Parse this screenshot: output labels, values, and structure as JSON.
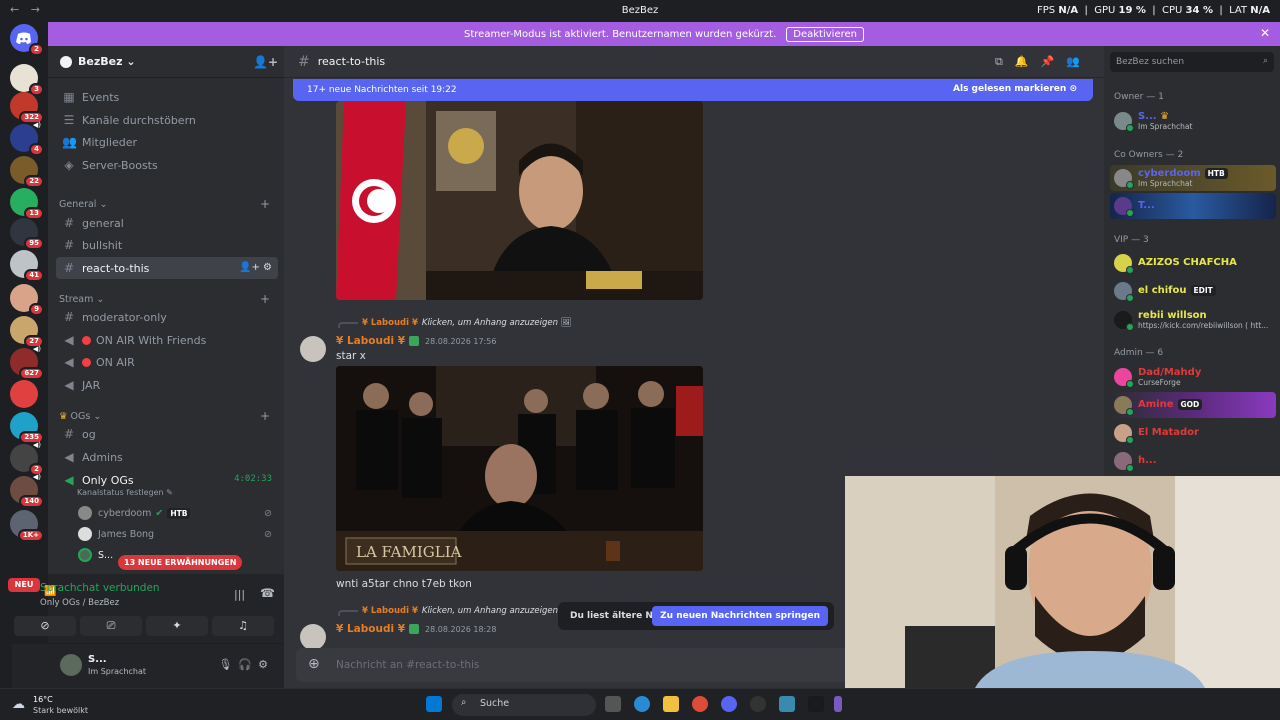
{
  "titlebar": {
    "nav": "← →",
    "title": "BezBez",
    "fps_label": "FPS",
    "fps": "N/A",
    "gpu_label": "GPU",
    "gpu": "19 %",
    "cpu_label": "CPU",
    "cpu": "34 %",
    "lat_label": "LAT",
    "lat": "N/A"
  },
  "banner": {
    "text": "Streamer-Modus ist aktiviert. Benutzernamen wurden gekürzt.",
    "button": "Deaktivieren",
    "close": "✕"
  },
  "servers": {
    "badges": [
      "2",
      "3",
      "322",
      "4",
      "22",
      "13",
      "95",
      "41",
      "9",
      "27",
      "627",
      "235",
      "2",
      "140",
      "1K+"
    ],
    "neu": "NEU"
  },
  "guild": {
    "name": "BezBez ⌄"
  },
  "nav_items": [
    "Events",
    "Kanäle durchstöbern",
    "Mitglieder",
    "Server-Boosts"
  ],
  "categories": {
    "general": "General ⌄",
    "stream": "Stream ⌄",
    "ogs": "OGs ⌄"
  },
  "channels": {
    "general": [
      "general",
      "bullshit",
      "react-to-this"
    ],
    "stream": [
      "moderator-only",
      "ON AIR With Friends",
      "ON AIR",
      "JAR"
    ],
    "ogs": [
      "og",
      "Admins",
      "Only OGs"
    ]
  },
  "voice": {
    "timer": "4:02:33",
    "status": "Kanalstatus festlegen",
    "users": [
      {
        "name": "cyberdoom",
        "tag": "HTB"
      },
      {
        "name": "James Bong"
      },
      {
        "name": "S..."
      }
    ],
    "mentions": "13 NEUE ERWÄHNUNGEN"
  },
  "voicepanel": {
    "title": "Sprachchat verbunden",
    "subtitle": "Only OGs / BezBez"
  },
  "user": {
    "name": "S...",
    "status": "Im Sprachchat"
  },
  "chat": {
    "channel": "react-to-this",
    "newbar": "17+ neue Nachrichten seit 19:22",
    "mark_read": "Als gelesen markieren",
    "messages": [
      {
        "reply_name": "¥ Laboudi ¥",
        "reply_text": "Klicken, um Anhang anzuzeigen",
        "author": "¥ Laboudi ¥",
        "date": "28.08.2026 17:56",
        "text": "star x",
        "caption": "wnti a5tar chno t7eb tkon",
        "sign": "LA FAMIGLIA"
      },
      {
        "reply_name": "¥ Laboudi ¥",
        "reply_text": "Klicken, um Anhang anzuzeigen",
        "author": "¥ Laboudi ¥",
        "date": "28.08.2026 18:28"
      }
    ],
    "jump_text": "Du liest ältere Nachrichten",
    "jump_button": "Zu neuen Nachrichten springen",
    "composer_placeholder": "Nachricht an #react-to-this"
  },
  "members": {
    "search_placeholder": "BezBez suchen",
    "groups": [
      {
        "title": "Owner — 1",
        "items": [
          {
            "name": "S...",
            "status": "Im Sprachchat",
            "color": "#5865f2"
          }
        ]
      },
      {
        "title": "Co Owners — 2",
        "items": [
          {
            "name": "cyberdoom",
            "status": "Im Sprachchat",
            "color": "#5865f2",
            "tag": "HTB"
          },
          {
            "name": "T...",
            "color": "#5865f2"
          }
        ]
      },
      {
        "title": "VIP — 3",
        "items": [
          {
            "name": "AZIZOS CHAFCHA",
            "color": "#e9e84a"
          },
          {
            "name": "el chifou",
            "color": "#e9e84a",
            "tag": "EDIT"
          },
          {
            "name": "rebii willson",
            "status": "https://kick.com/rebiiwillson ( htt...",
            "color": "#e9e84a"
          }
        ]
      },
      {
        "title": "Admin — 6",
        "items": [
          {
            "name": "Dad/Mahdy",
            "status": "CurseForge",
            "color": "#e03a3a"
          },
          {
            "name": "Amine",
            "color": "#e03a3a",
            "tag": "GOD"
          },
          {
            "name": "El Matador",
            "color": "#e03a3a"
          },
          {
            "name": "h...",
            "color": "#e03a3a"
          }
        ]
      }
    ]
  },
  "taskbar": {
    "temp": "16°C",
    "weather": "Stark bewölkt",
    "search": "Suche"
  },
  "colors": {
    "accent": "#5865f2",
    "banner": "#a45de0",
    "danger": "#da373c",
    "online": "#23a55a"
  }
}
